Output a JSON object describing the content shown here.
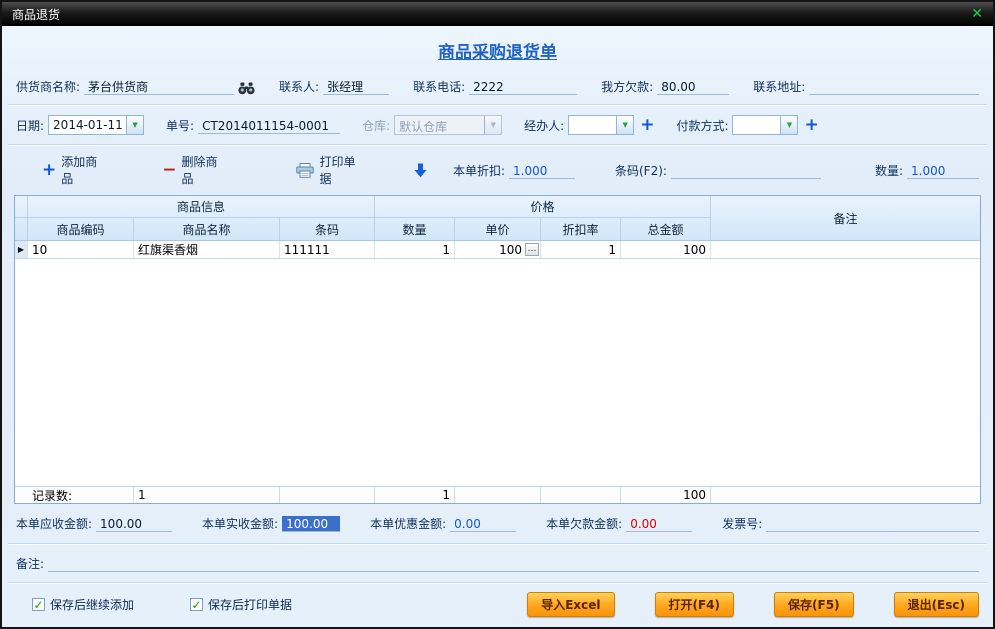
{
  "window": {
    "title": "商品退货"
  },
  "icons": {
    "close": "✕",
    "combo_arrow": "▼",
    "plus": "+",
    "minus": "−",
    "check": "✓",
    "row_marker": "▶",
    "ellipsis": "…"
  },
  "doc": {
    "title": "商品采购退货单"
  },
  "header": {
    "supplier": {
      "label": "供货商名称:",
      "value": "茅台供货商"
    },
    "contact": {
      "label": "联系人:",
      "value": "张经理"
    },
    "phone": {
      "label": "联系电话:",
      "value": "2222"
    },
    "our_debt": {
      "label": "我方欠款:",
      "value": "80.00"
    },
    "address": {
      "label": "联系地址:",
      "value": ""
    }
  },
  "order": {
    "date": {
      "label": "日期:",
      "value": "2014-01-11"
    },
    "number": {
      "label": "单号:",
      "value": "CT2014011154-0001"
    },
    "warehouse": {
      "label": "仓库:",
      "value": "默认仓库"
    },
    "operator": {
      "label": "经办人:",
      "value": ""
    },
    "payment": {
      "label": "付款方式:",
      "value": ""
    }
  },
  "toolbar": {
    "add": "添加商品",
    "remove": "删除商品",
    "print": "打印单据",
    "discount": {
      "label": "本单折扣:",
      "value": "1.000"
    },
    "barcode": {
      "label": "条码(F2):",
      "value": ""
    },
    "qty": {
      "label": "数量:",
      "value": "1.000"
    }
  },
  "table": {
    "groups": {
      "info": "商品信息",
      "price": "价格",
      "note": "备注"
    },
    "columns": [
      "商品编码",
      "商品名称",
      "条码",
      "数量",
      "单价",
      "折扣率",
      "总金额"
    ],
    "row": {
      "code": "10",
      "name": "红旗渠香烟",
      "barcode": "111111",
      "qty": "1",
      "price": "100",
      "rate": "1",
      "total": "100",
      "note": ""
    },
    "footer": {
      "label": "记录数:",
      "count": "1",
      "qty_total": "1",
      "amount_total": "100"
    }
  },
  "summary": {
    "receivable": {
      "label": "本单应收金额:",
      "value": "100.00"
    },
    "received": {
      "label": "本单实收金额:",
      "value": "100.00"
    },
    "discount": {
      "label": "本单优惠金额:",
      "value": "0.00"
    },
    "debt": {
      "label": "本单欠款金额:",
      "value": "0.00"
    },
    "invoice": {
      "label": "发票号:",
      "value": ""
    }
  },
  "note": {
    "label": "备注:",
    "value": ""
  },
  "bottom": {
    "checkbox_continue": "保存后继续添加",
    "checkbox_print": "保存后打印单据",
    "buttons": [
      "导入Excel",
      "打开(F4)",
      "保存(F5)",
      "退出(Esc)"
    ]
  }
}
